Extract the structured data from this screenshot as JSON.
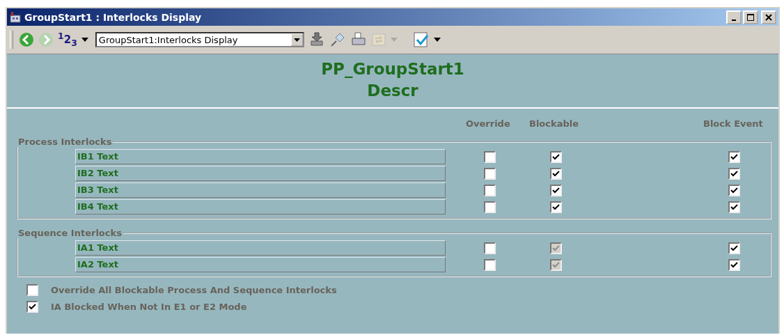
{
  "window": {
    "title": "GroupStart1 : Interlocks Display"
  },
  "toolbar": {
    "numbers_label": "$^{1}$2$_{3}$",
    "display_select": {
      "value": "GroupStart1:Interlocks Display"
    }
  },
  "header": {
    "title": "PP_GroupStart1",
    "subtitle": "Descr"
  },
  "columns": [
    "Override",
    "Blockable",
    "Block Event"
  ],
  "groups": [
    {
      "title": "Process Interlocks",
      "rows": [
        {
          "label": "IB1 Text",
          "override": {
            "checked": false,
            "disabled": false
          },
          "blockable": {
            "checked": true,
            "disabled": false
          },
          "block_event": {
            "checked": true,
            "disabled": false
          }
        },
        {
          "label": "IB2 Text",
          "override": {
            "checked": false,
            "disabled": false
          },
          "blockable": {
            "checked": true,
            "disabled": false
          },
          "block_event": {
            "checked": true,
            "disabled": false
          }
        },
        {
          "label": "IB3 Text",
          "override": {
            "checked": false,
            "disabled": false
          },
          "blockable": {
            "checked": true,
            "disabled": false
          },
          "block_event": {
            "checked": true,
            "disabled": false
          }
        },
        {
          "label": "IB4 Text",
          "override": {
            "checked": false,
            "disabled": false
          },
          "blockable": {
            "checked": true,
            "disabled": false
          },
          "block_event": {
            "checked": true,
            "disabled": false
          }
        }
      ]
    },
    {
      "title": "Sequence Interlocks",
      "rows": [
        {
          "label": "IA1 Text",
          "override": {
            "checked": false,
            "disabled": false
          },
          "blockable": {
            "checked": true,
            "disabled": true
          },
          "block_event": {
            "checked": true,
            "disabled": false
          }
        },
        {
          "label": "IA2 Text",
          "override": {
            "checked": false,
            "disabled": false
          },
          "blockable": {
            "checked": true,
            "disabled": true
          },
          "block_event": {
            "checked": true,
            "disabled": false
          }
        }
      ]
    }
  ],
  "options": [
    {
      "label": "Override All Blockable Process And Sequence Interlocks",
      "checked": false
    },
    {
      "label": "IA Blocked When Not In E1 or E2 Mode",
      "checked": true
    }
  ]
}
